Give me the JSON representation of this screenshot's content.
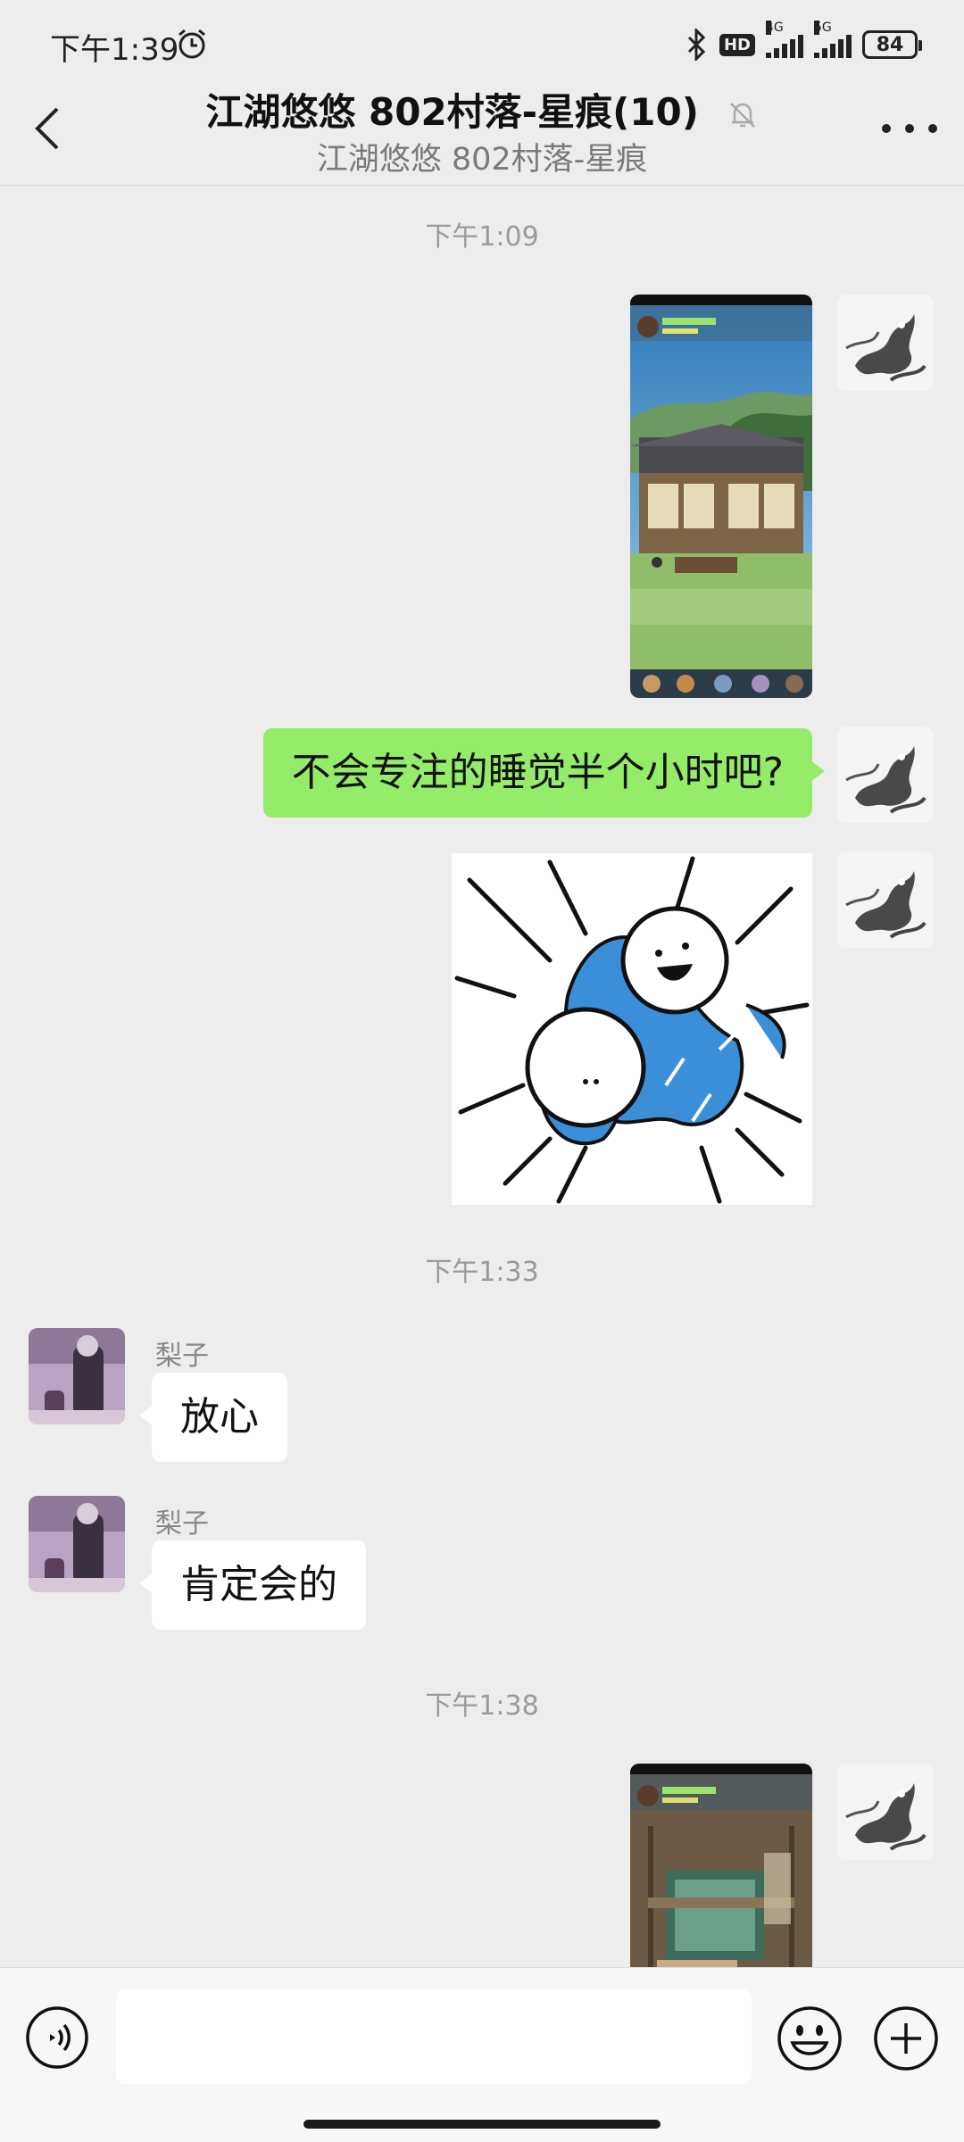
{
  "status_bar": {
    "time": "下午1:39",
    "hd_label": "HD",
    "net1": "4G",
    "net2": "5G",
    "battery": "84"
  },
  "header": {
    "title": "江湖悠悠 802村落-星痕(10)",
    "subtitle": "江湖悠悠 802村落-星痕"
  },
  "messages": {
    "ts1": "下午1:09",
    "me_text": "不会专注的睡觉半个小时吧?",
    "ts2": "下午1:33",
    "other1_name": "梨子",
    "other1_text": "放心",
    "other2_name": "梨子",
    "other2_text": "肯定会的",
    "ts3": "下午1:38"
  },
  "input": {
    "placeholder": "",
    "value": ""
  },
  "colors": {
    "my_bubble": "#95ec69",
    "background": "#ededed",
    "sticker_blue": "#3b8fd8"
  }
}
